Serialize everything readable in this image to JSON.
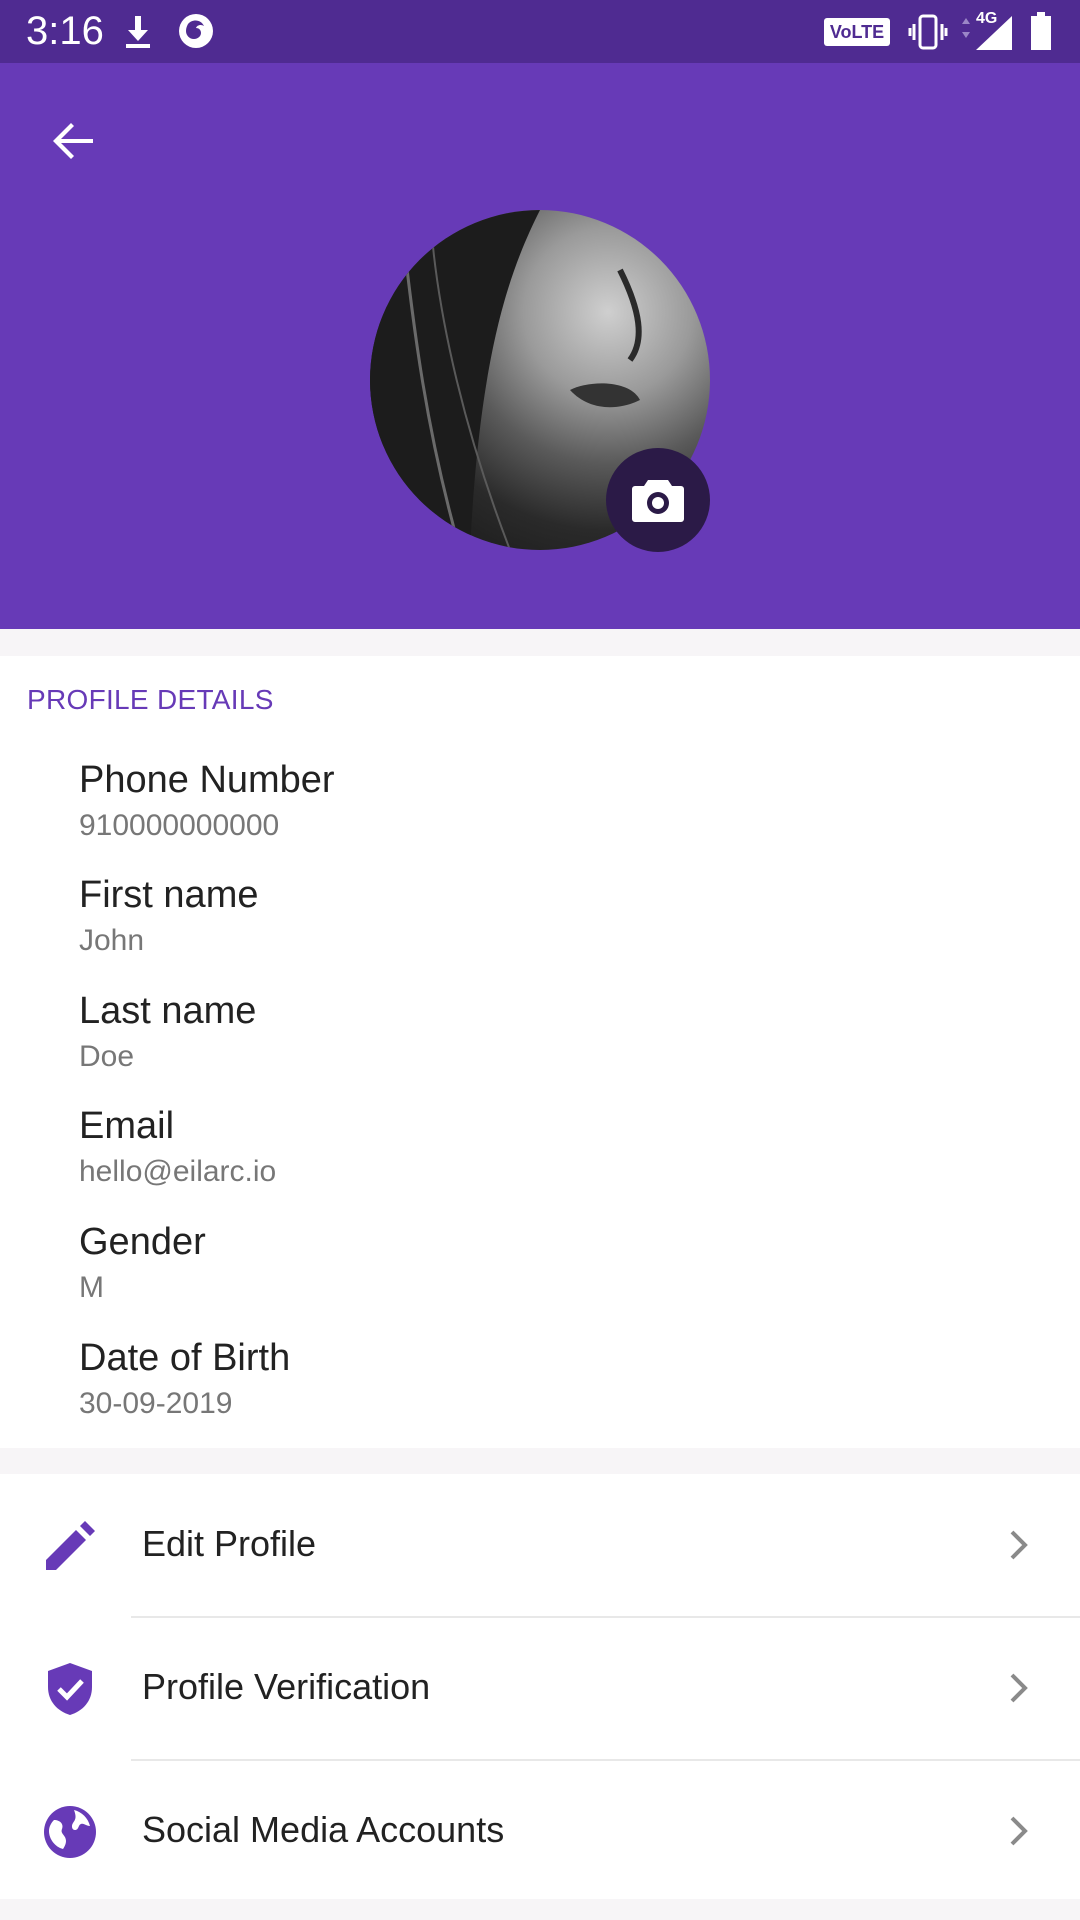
{
  "status_bar": {
    "time": "3:16",
    "volte": "VoLTE",
    "network": "4G"
  },
  "colors": {
    "primary": "#673ab7",
    "status_bar": "#4f2b91",
    "accent_text": "#673ab7"
  },
  "header": {
    "back_icon": "arrow-left-icon",
    "camera_icon": "camera-icon"
  },
  "profile_details": {
    "title": "PROFILE DETAILS",
    "fields": [
      {
        "label": "Phone Number",
        "value": "910000000000"
      },
      {
        "label": "First name",
        "value": "John"
      },
      {
        "label": "Last name",
        "value": "Doe"
      },
      {
        "label": "Email",
        "value": "hello@eilarc.io"
      },
      {
        "label": "Gender",
        "value": "M"
      },
      {
        "label": "Date of Birth",
        "value": "30-09-2019"
      }
    ]
  },
  "menu": {
    "items": [
      {
        "label": "Edit Profile",
        "icon": "pencil-icon"
      },
      {
        "label": "Profile Verification",
        "icon": "shield-check-icon"
      },
      {
        "label": "Social Media Accounts",
        "icon": "globe-icon"
      }
    ]
  }
}
